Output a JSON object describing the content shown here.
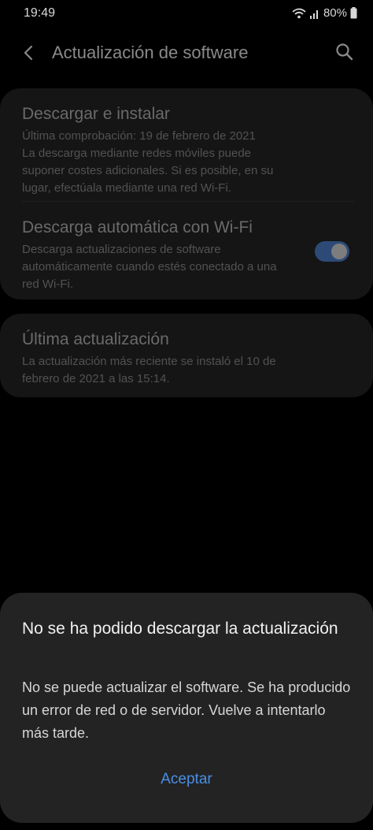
{
  "status_bar": {
    "time": "19:49",
    "battery": "80%"
  },
  "header": {
    "title": "Actualización de software"
  },
  "settings": {
    "download_install": {
      "title": "Descargar e instalar",
      "subtitle": "Última comprobación: 19 de febrero de 2021\nLa descarga mediante redes móviles puede suponer costes adicionales. Si es posible, en su lugar, efectúala mediante una red Wi-Fi."
    },
    "auto_download": {
      "title": "Descarga automática con Wi-Fi",
      "subtitle": "Descarga actualizaciones de software automáticamente cuando estés conectado a una red Wi-Fi.",
      "enabled": true
    },
    "last_update": {
      "title": "Última actualización",
      "subtitle": "La actualización más reciente se instaló el 10 de febrero de 2021 a las 15:14."
    }
  },
  "dialog": {
    "title": "No se ha podido descargar la actualización",
    "message": "No se puede actualizar el software. Se ha producido un error de red o de servidor. Vuelve a intentarlo más tarde.",
    "button_label": "Aceptar"
  },
  "colors": {
    "accent": "#4a8fe6",
    "toggle_track": "#2d4a77"
  }
}
